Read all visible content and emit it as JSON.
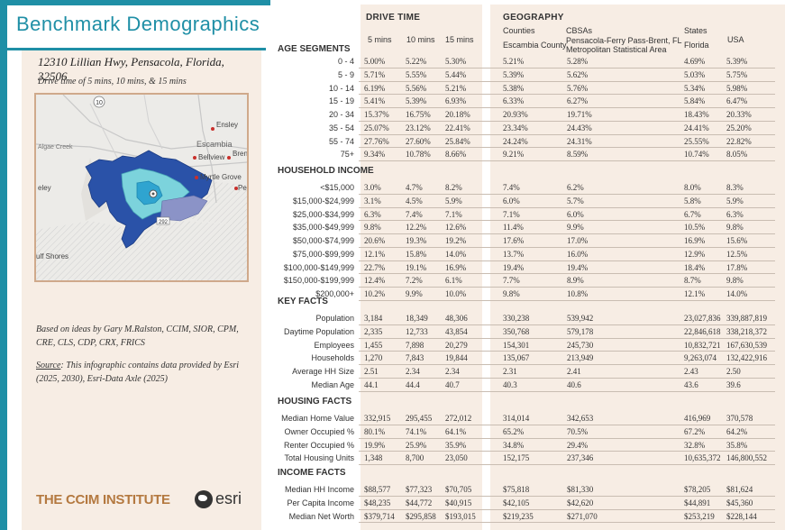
{
  "title": "Benchmark Demographics",
  "address": "12310 Lillian Hwy, Pensacola, Florida, 32506",
  "drive_note": "Drive time of 5 mins, 10 mins, & 15 mins",
  "map": {
    "route_label": "10",
    "road_label": "292",
    "places": [
      "Ensley",
      "Escambia",
      "Bellview",
      "Brent",
      "Myrtle Grove",
      "Pensacola",
      "Algae Creek",
      "Perdido Key",
      "Gulf Shores"
    ],
    "shown_places": {
      "ensley": "Ensley",
      "escambia": "Escambia",
      "bellview": "Bellview",
      "brent": "Brent",
      "myrtle": "Myrtle Grove",
      "pens": "Pen",
      "creek": "Algae Creek",
      "eley": "eley",
      "gulf": "ulf Shores"
    }
  },
  "credits": {
    "based_on": "Based on ideas by Gary M.Ralston, CCIM, SIOR, CPM, CRE, CLS, CDP, CRX, FRICS",
    "source_label": "Source",
    "source_text": ": This infographic contains data provided by Esri (2025, 2030), Esri-Data Axle (2025)"
  },
  "logos": {
    "ccim": "THE CCIM INSTITUTE",
    "esri": "esri"
  },
  "headers": {
    "drive_time": "DRIVE TIME",
    "geography": "GEOGRAPHY",
    "age_segments": "AGE SEGMENTS",
    "counties": "Counties",
    "cbsas": "CBSAs",
    "states": "States",
    "usa": "USA",
    "m5": "5 mins",
    "m10": "10 mins",
    "m15": "15 mins",
    "county_name": "Escambia County",
    "cbsa_name_1": "Pensacola-Ferry Pass-Brent, FL",
    "cbsa_name_2": "Metropolitan Statistical Area",
    "state_name": "Florida"
  },
  "sections": [
    {
      "title": "",
      "rows": [
        {
          "label": "0 - 4",
          "values": [
            "5.00%",
            "5.22%",
            "5.30%",
            "5.21%",
            "5.28%",
            "4.69%",
            "5.39%"
          ]
        },
        {
          "label": "5 - 9",
          "values": [
            "5.71%",
            "5.55%",
            "5.44%",
            "5.39%",
            "5.62%",
            "5.03%",
            "5.75%"
          ]
        },
        {
          "label": "10 - 14",
          "values": [
            "6.19%",
            "5.56%",
            "5.21%",
            "5.38%",
            "5.76%",
            "5.34%",
            "5.98%"
          ]
        },
        {
          "label": "15 - 19",
          "values": [
            "5.41%",
            "5.39%",
            "6.93%",
            "6.33%",
            "6.27%",
            "5.84%",
            "6.47%"
          ]
        },
        {
          "label": "20 - 34",
          "values": [
            "15.37%",
            "16.75%",
            "20.18%",
            "20.93%",
            "19.71%",
            "18.43%",
            "20.33%"
          ]
        },
        {
          "label": "35 - 54",
          "values": [
            "25.07%",
            "23.12%",
            "22.41%",
            "23.34%",
            "24.43%",
            "24.41%",
            "25.20%"
          ]
        },
        {
          "label": "55 - 74",
          "values": [
            "27.76%",
            "27.60%",
            "25.84%",
            "24.24%",
            "24.31%",
            "25.55%",
            "22.82%"
          ]
        },
        {
          "label": "75+",
          "values": [
            "9.34%",
            "10.78%",
            "8.66%",
            "9.21%",
            "8.59%",
            "10.74%",
            "8.05%"
          ]
        }
      ]
    },
    {
      "title": "HOUSEHOLD INCOME",
      "rows": [
        {
          "label": "<$15,000",
          "values": [
            "3.0%",
            "4.7%",
            "8.2%",
            "7.4%",
            "6.2%",
            "8.0%",
            "8.3%"
          ]
        },
        {
          "label": "$15,000-$24,999",
          "values": [
            "3.1%",
            "4.5%",
            "5.9%",
            "6.0%",
            "5.7%",
            "5.8%",
            "5.9%"
          ]
        },
        {
          "label": "$25,000-$34,999",
          "values": [
            "6.3%",
            "7.4%",
            "7.1%",
            "7.1%",
            "6.0%",
            "6.7%",
            "6.3%"
          ]
        },
        {
          "label": "$35,000-$49,999",
          "values": [
            "9.8%",
            "12.2%",
            "12.6%",
            "11.4%",
            "9.9%",
            "10.5%",
            "9.8%"
          ]
        },
        {
          "label": "$50,000-$74,999",
          "values": [
            "20.6%",
            "19.3%",
            "19.2%",
            "17.6%",
            "17.0%",
            "16.9%",
            "15.6%"
          ]
        },
        {
          "label": "$75,000-$99,999",
          "values": [
            "12.1%",
            "15.8%",
            "14.0%",
            "13.7%",
            "16.0%",
            "12.9%",
            "12.5%"
          ]
        },
        {
          "label": "$100,000-$149,999",
          "values": [
            "22.7%",
            "19.1%",
            "16.9%",
            "19.4%",
            "19.4%",
            "18.4%",
            "17.8%"
          ]
        },
        {
          "label": "$150,000-$199,999",
          "values": [
            "12.4%",
            "7.2%",
            "6.1%",
            "7.7%",
            "8.9%",
            "8.7%",
            "9.8%"
          ]
        },
        {
          "label": "$200,000+",
          "values": [
            "10.2%",
            "9.9%",
            "10.0%",
            "9.8%",
            "10.8%",
            "12.1%",
            "14.0%"
          ]
        }
      ]
    },
    {
      "title": "KEY FACTS",
      "rows": [
        {
          "label": "Population",
          "values": [
            "3,184",
            "18,349",
            "48,306",
            "330,238",
            "539,942",
            "23,027,836",
            "339,887,819"
          ]
        },
        {
          "label": "Daytime Population",
          "values": [
            "2,335",
            "12,733",
            "43,854",
            "350,768",
            "579,178",
            "22,846,618",
            "338,218,372"
          ]
        },
        {
          "label": "Employees",
          "values": [
            "1,455",
            "7,898",
            "20,279",
            "154,301",
            "245,730",
            "10,832,721",
            "167,630,539"
          ]
        },
        {
          "label": "Households",
          "values": [
            "1,270",
            "7,843",
            "19,844",
            "135,067",
            "213,949",
            "9,263,074",
            "132,422,916"
          ]
        },
        {
          "label": "Average HH Size",
          "values": [
            "2.51",
            "2.34",
            "2.34",
            "2.31",
            "2.41",
            "2.43",
            "2.50"
          ]
        },
        {
          "label": "Median Age",
          "values": [
            "44.1",
            "44.4",
            "40.7",
            "40.3",
            "40.6",
            "43.6",
            "39.6"
          ]
        }
      ]
    },
    {
      "title": "HOUSING FACTS",
      "rows": [
        {
          "label": "Median Home Value",
          "values": [
            "332,915",
            "295,455",
            "272,012",
            "314,014",
            "342,653",
            "416,969",
            "370,578"
          ]
        },
        {
          "label": "Owner Occupied %",
          "values": [
            "80.1%",
            "74.1%",
            "64.1%",
            "65.2%",
            "70.5%",
            "67.2%",
            "64.2%"
          ]
        },
        {
          "label": "Renter Occupied %",
          "values": [
            "19.9%",
            "25.9%",
            "35.9%",
            "34.8%",
            "29.4%",
            "32.8%",
            "35.8%"
          ]
        },
        {
          "label": "Total Housing Units",
          "values": [
            "1,348",
            "8,700",
            "23,050",
            "152,175",
            "237,346",
            "10,635,372",
            "146,800,552"
          ]
        }
      ]
    },
    {
      "title": "INCOME FACTS",
      "rows": [
        {
          "label": "Median HH Income",
          "values": [
            "$88,577",
            "$77,323",
            "$70,705",
            "$75,818",
            "$81,330",
            "$78,205",
            "$81,624"
          ]
        },
        {
          "label": "Per Capita Income",
          "values": [
            "$48,235",
            "$44,772",
            "$40,915",
            "$42,105",
            "$42,620",
            "$44,891",
            "$45,360"
          ]
        },
        {
          "label": "Median Net Worth",
          "values": [
            "$379,714",
            "$295,858",
            "$193,015",
            "$219,235",
            "$271,070",
            "$253,219",
            "$228,144"
          ]
        }
      ]
    }
  ]
}
